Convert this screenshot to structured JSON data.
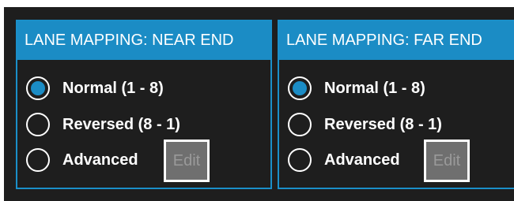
{
  "panels": [
    {
      "title": "LANE MAPPING: NEAR END",
      "options": [
        {
          "label": "Normal (1 - 8)",
          "selected": true
        },
        {
          "label": "Reversed (8 - 1)",
          "selected": false
        },
        {
          "label": "Advanced",
          "selected": false
        }
      ],
      "edit_label": "Edit"
    },
    {
      "title": "LANE MAPPING: FAR END",
      "options": [
        {
          "label": "Normal (1 - 8)",
          "selected": true
        },
        {
          "label": "Reversed (8 - 1)",
          "selected": false
        },
        {
          "label": "Advanced",
          "selected": false
        }
      ],
      "edit_label": "Edit"
    }
  ],
  "colors": {
    "accent": "#1b8cc5",
    "background": "#1e1e1e",
    "disabled_button": "#6f6f6f"
  }
}
